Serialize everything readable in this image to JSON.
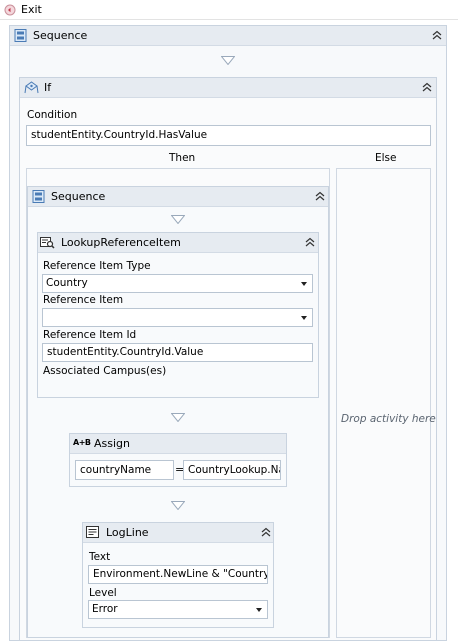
{
  "titlebar": {
    "title": "Exit"
  },
  "sequence_outer": {
    "title": "Sequence"
  },
  "if_block": {
    "title": "If",
    "condition_label": "Condition",
    "condition_value": "studentEntity.CountryId.HasValue",
    "then_label": "Then",
    "else_label": "Else",
    "else_placeholder": "Drop activity here"
  },
  "sequence_inner": {
    "title": "Sequence"
  },
  "lookup": {
    "title": "LookupReferenceItem",
    "ref_type_label": "Reference Item Type",
    "ref_type_value": "Country",
    "ref_item_label": "Reference Item",
    "ref_item_value": "",
    "ref_id_label": "Reference Item Id",
    "ref_id_value": "studentEntity.CountryId.Value",
    "campus_label": "Associated Campus(es)"
  },
  "assign": {
    "title": "Assign",
    "icon_text": "A+B",
    "to_value": "countryName",
    "equals": "=",
    "value_value": "CountryLookup.Na"
  },
  "logline": {
    "title": "LogLine",
    "text_label": "Text",
    "text_value": "Environment.NewLine & \"Country:\"",
    "level_label": "Level",
    "level_value": "Error"
  },
  "colors": {
    "header_bg": "#e6ebf1",
    "border": "#c9d3df",
    "arrow": "#9aa9bb"
  }
}
